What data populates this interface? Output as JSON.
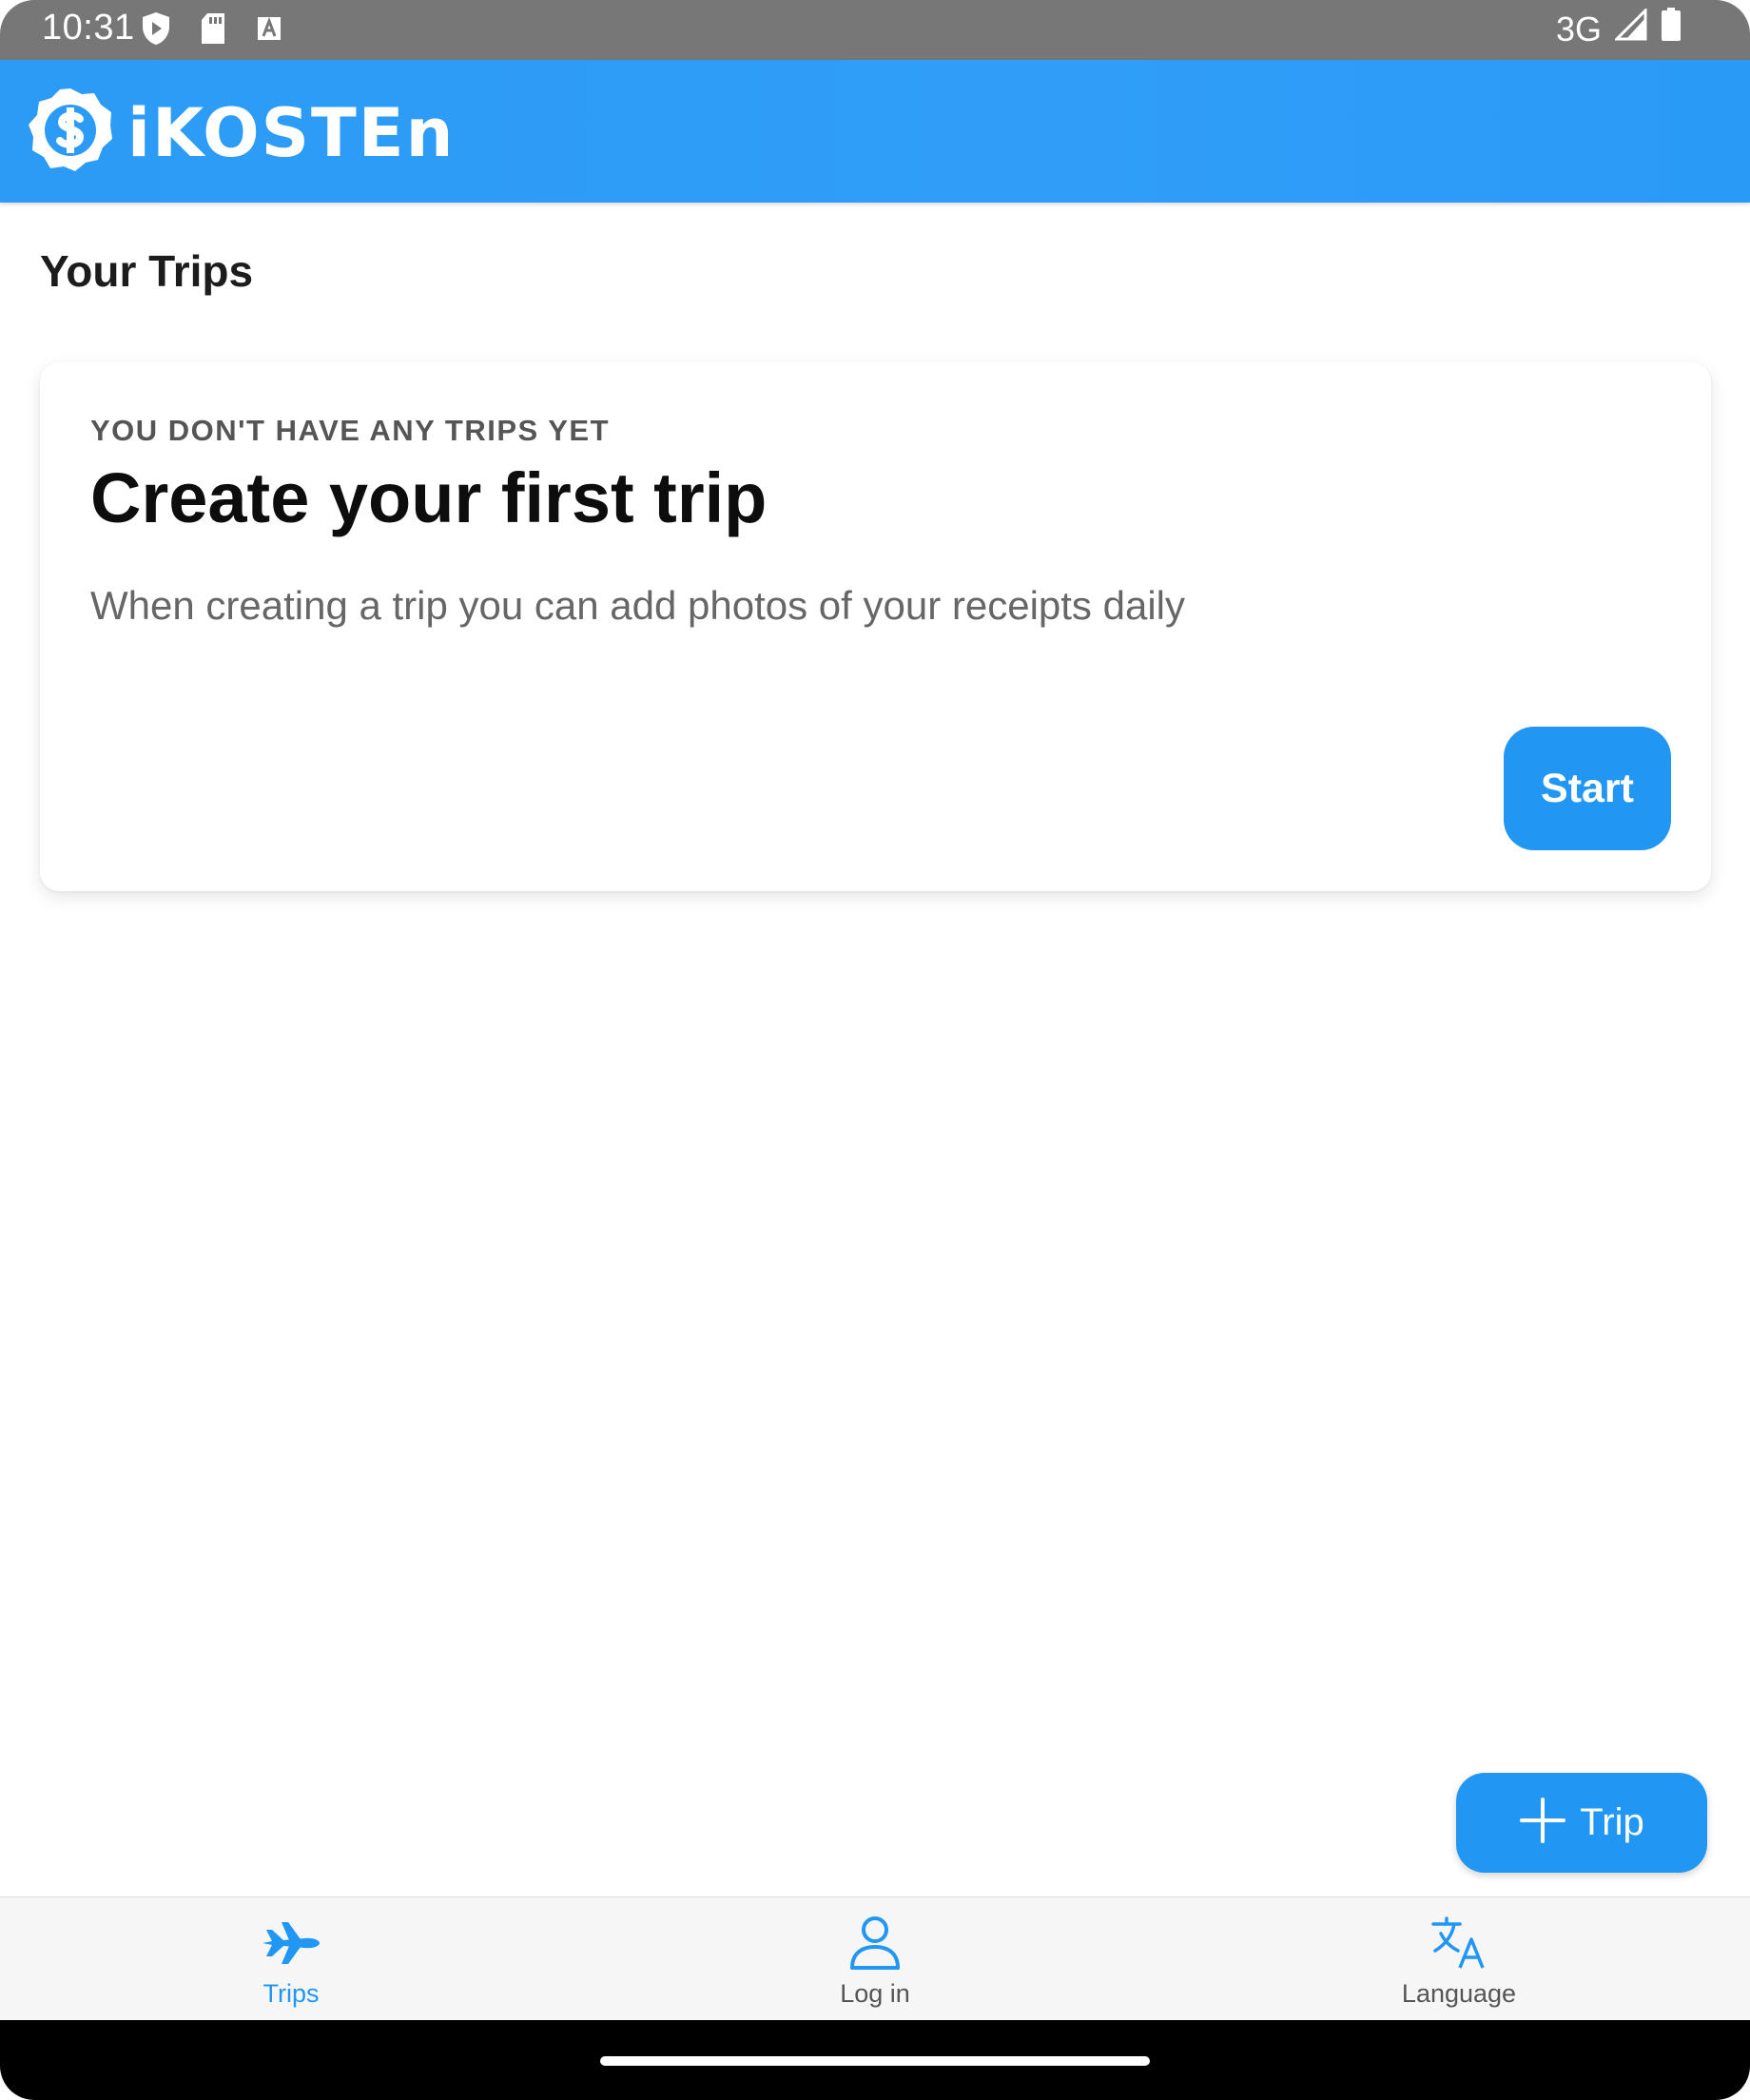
{
  "status_bar": {
    "time": "10:31",
    "network": "3G",
    "icons": [
      "shield-play-icon",
      "sd-card-icon",
      "a-font-icon",
      "signal-icon",
      "battery-icon"
    ]
  },
  "app_bar": {
    "logo_text": "iKOSTEn"
  },
  "page": {
    "title": "Your Trips"
  },
  "empty_card": {
    "overline": "YOU DON'T HAVE ANY TRIPS YET",
    "title": "Create your first trip",
    "body": "When creating a trip you can add photos of your receipts daily",
    "start_label": "Start"
  },
  "fab": {
    "label": "Trip",
    "icon": "plus-icon"
  },
  "bottom_nav": {
    "items": [
      {
        "label": "Trips",
        "icon": "airplane-icon",
        "active": true
      },
      {
        "label": "Log in",
        "icon": "person-icon",
        "active": false
      },
      {
        "label": "Language",
        "icon": "translate-icon",
        "active": false
      }
    ]
  },
  "colors": {
    "primary": "#2196f3",
    "status_bar": "#777777",
    "text_muted": "#666666"
  }
}
